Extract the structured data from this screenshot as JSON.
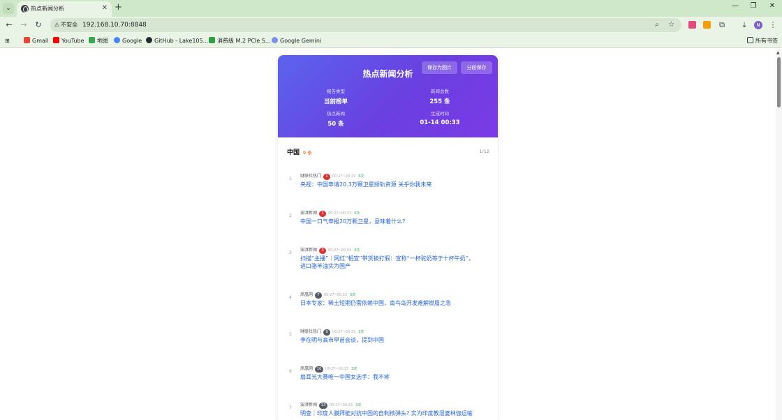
{
  "browser": {
    "tab_title": "热点新闻分析",
    "url": "192.168.10.70:8848",
    "security_label": "不安全",
    "avatar_initial": "N",
    "bookmarks": [
      {
        "label": "Gmail"
      },
      {
        "label": "YouTube"
      },
      {
        "label": "地图"
      },
      {
        "label": "Google"
      },
      {
        "label": "GitHub - Lake105..."
      },
      {
        "label": "消费级 M.2 PCIe S..."
      },
      {
        "label": "Google Gemini"
      }
    ],
    "all_bookmarks_label": "所有书签"
  },
  "report": {
    "title": "热点新闻分析",
    "save_image_label": "保存为图片",
    "save_split_label": "分段保存",
    "stats": [
      {
        "label": "报告类型",
        "value": "当前榜单"
      },
      {
        "label": "新闻总数",
        "value": "255 条"
      },
      {
        "label": "热点新闻",
        "value": "50 条"
      },
      {
        "label": "生成时间",
        "value": "01-14 00:33"
      }
    ],
    "section": {
      "name": "中国",
      "count": "9 条",
      "page": "1/12"
    },
    "items": [
      {
        "rank": "1",
        "source": "财联社热门",
        "badge": "1",
        "badge_color": "#e03131",
        "time": "00:27~00:33",
        "times": "3次",
        "title": "央视：中国申请20.3万颗卫星频轨资源 关乎你我未来"
      },
      {
        "rank": "2",
        "source": "澎湃新闻",
        "badge": "1",
        "badge_color": "#e03131",
        "time": "00:27~00:33",
        "times": "3次",
        "title": "中国一口气申报20万颗卫星，意味着什么?"
      },
      {
        "rank": "3",
        "source": "澎湃新闻",
        "badge": "3",
        "badge_color": "#e03131",
        "time": "00:27~00:33",
        "times": "3次",
        "title": "扫描“主播”｜网红“相宜”带货被打假：宣称“一杯驼奶等于十杯牛奶”，进口骆羊油实为国产"
      },
      {
        "rank": "4",
        "source": "凤凰网",
        "badge": "7",
        "badge_color": "#555a63",
        "time": "00:27~00:33",
        "times": "3次",
        "title": "日本专家：稀土短期仍需依赖中国，南鸟岛开发难解燃眉之急"
      },
      {
        "rank": "5",
        "source": "财联社热门",
        "badge": "9",
        "badge_color": "#555a63",
        "time": "00:27~00:33",
        "times": "3次",
        "title": "李在明与高市早苗会谈，提到中国"
      },
      {
        "rank": "6",
        "source": "凤凰网",
        "badge": "10",
        "badge_color": "#555a63",
        "time": "00:27~00:33",
        "times": "3次",
        "title": "扇耳光大赛唯一中国女选手：我不疼"
      },
      {
        "rank": "7",
        "source": "澎湃新闻",
        "badge": "13",
        "badge_color": "#555a63",
        "time": "00:27~00:33",
        "times": "3次",
        "title": "明查｜印度人膜拜能对抗中国的自制核弹头? 实为印度教湿婆林伽运输"
      }
    ]
  }
}
